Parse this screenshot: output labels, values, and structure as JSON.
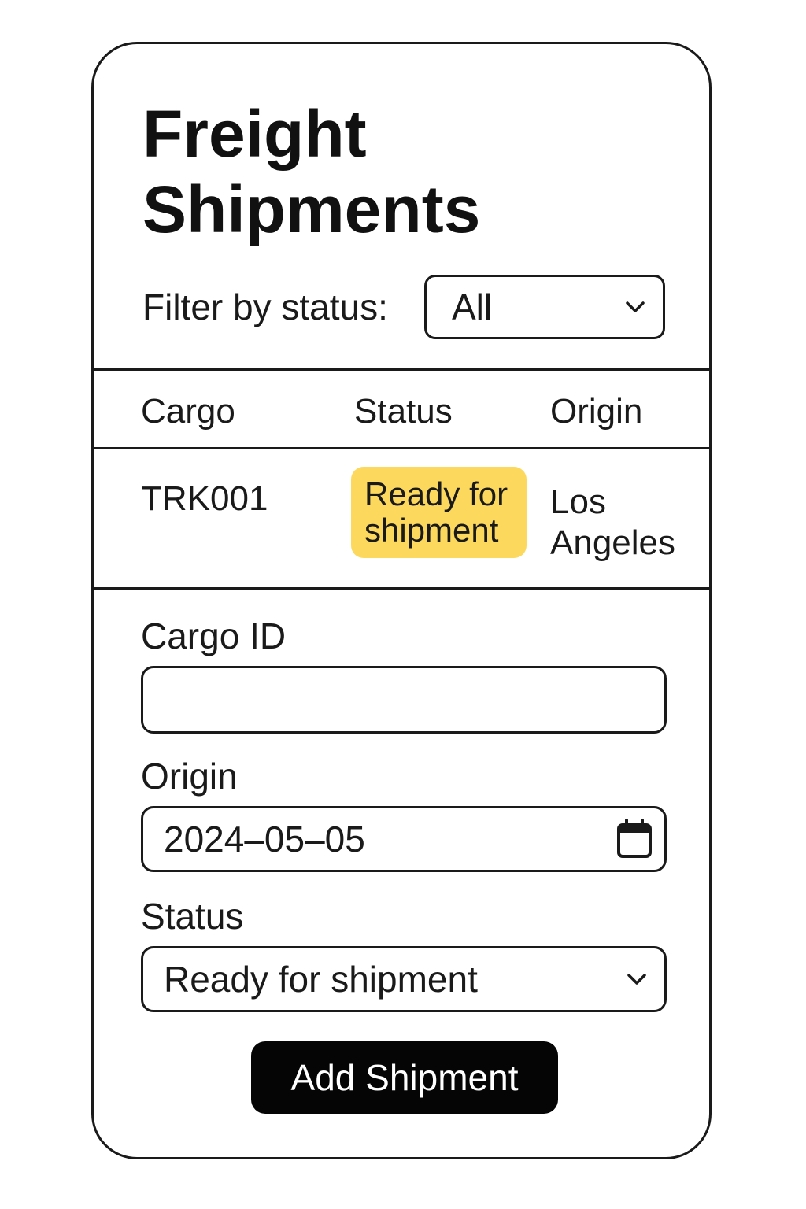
{
  "header": {
    "title_line1": "Freight",
    "title_line2": "Shipments"
  },
  "filter": {
    "label": "Filter by status:",
    "selected": "All",
    "icon": "chevron-down-icon"
  },
  "table": {
    "columns": [
      "Cargo",
      "Status",
      "Origin"
    ],
    "rows": [
      {
        "cargo": "TRK001",
        "status_line1": "Ready for",
        "status_line2": "shipment",
        "origin_line1": "Los",
        "origin_line2": "Angeles"
      }
    ],
    "status_badge_color": "#fcd95c"
  },
  "form": {
    "cargo_id": {
      "label": "Cargo ID",
      "value": ""
    },
    "origin": {
      "label": "Origin",
      "value": "2024–05–05",
      "icon": "calendar-icon"
    },
    "status": {
      "label": "Status",
      "selected": "Ready for shipment",
      "icon": "chevron-down-icon"
    },
    "submit_label": "Add Shipment"
  }
}
